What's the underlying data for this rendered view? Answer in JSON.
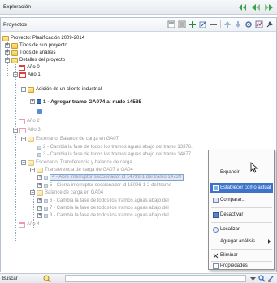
{
  "window": {
    "title": "Exploración"
  },
  "panel": {
    "title": "Proyectos"
  },
  "tree": {
    "root": "Proyecto: Planificación 2009-2014",
    "sub_types": "Tipos de sub proyecto",
    "analysis_types": "Tipos de análisis",
    "details": "Detalles del proyecto",
    "year0": "Año 0",
    "year1": "Año 1",
    "addition": "Adición de un cliente industrial",
    "step1": "1 - Agregar tramo GA074  al  nudo 14585",
    "year2": "Año 2",
    "year3": "Año 3",
    "scenario1": "Escenario: Balance de carga en GA07",
    "s1_item2": "2 - Cambia la fase de todos los tramos aguas abajo del tramo 13376.",
    "s1_item3": "3 - Cambia la fase de todos los tramos aguas abajo del tramo 14677.",
    "scenario2": "Escenario: Transferencia y balance de carga",
    "transfer": "Transferencia de carga de GA07 a GA04",
    "t_item4": "4 - Abre interruptor seccionador id 14739-1 del tramo 14739",
    "t_item5": "5 - Cierra interruptor seccionador id 15096-1-2 del tramo",
    "balance": "Balance de carga en GA04",
    "b_item6": "6 - Cambia la fase de todos los tramos aguas abajo del",
    "b_item7": "7 - Cambia la fase de todos los tramos aguas abajo del",
    "b_item8": "8 - Cambia la fase de todos los tramos aguas abajo del",
    "year4": "Año 4"
  },
  "context_menu": {
    "expand": "Expandir",
    "set_current": "Establecer como actual",
    "compare": "Comparar...",
    "deactivate": "Desactivar",
    "locate": "Localizar",
    "add_analysis": "Agregar análisis",
    "delete": "Eliminar",
    "properties": "Propiedades"
  },
  "search": {
    "label": "Buscar",
    "value": ""
  },
  "colors": {
    "accent": "#3d74c9",
    "nav_green": "#3aa04a",
    "highlight": "#dde8f8"
  }
}
